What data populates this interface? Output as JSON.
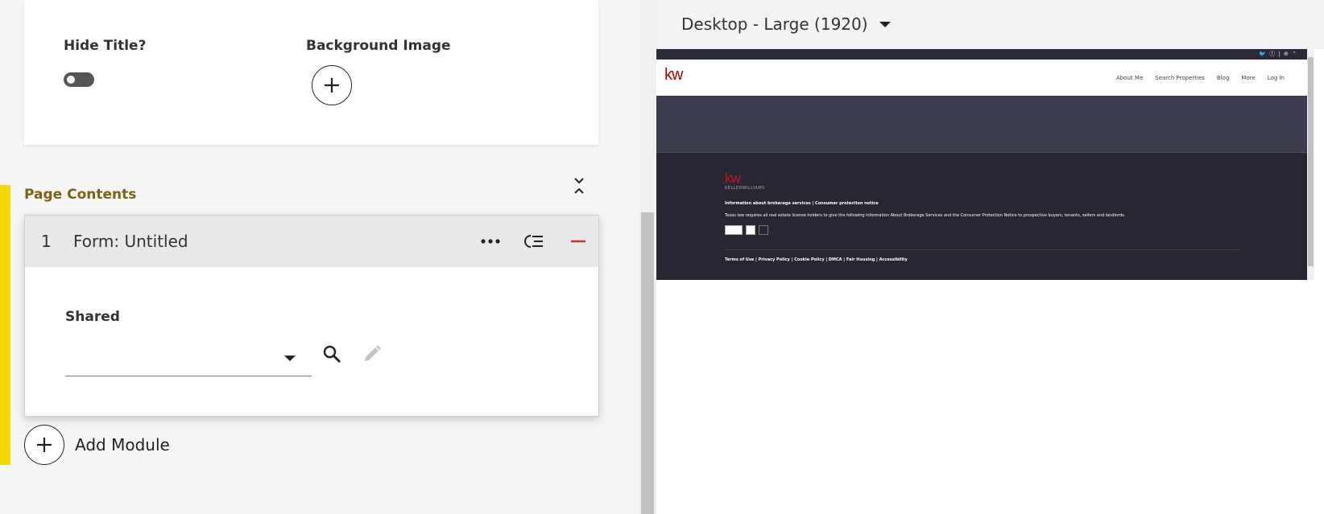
{
  "settings": {
    "hide_title_label": "Hide Title?",
    "hide_title_value": false,
    "background_image_label": "Background Image"
  },
  "page_contents": {
    "label": "Page Contents",
    "modules": [
      {
        "index": "1",
        "title": "Form: Untitled",
        "shared_label": "Shared",
        "shared_value": ""
      }
    ],
    "add_module_label": "Add Module"
  },
  "preview": {
    "device_label": "Desktop - Large (1920)",
    "logo": "kw",
    "topbar_icons": "🐦 ⓕ | ⊕ ⌃",
    "nav_items": [
      "About Me",
      "Search Properties",
      "Blog",
      "More",
      "Log In"
    ],
    "footer": {
      "logo": "kw",
      "logo_sub": "KELLERWILLIAMS",
      "links_line": "Information about brokerage services  |  Consumer protection notice",
      "notice": "Texas law requires all real estate license holders to give the following information About Brokerage Services and the Consumer Protection Notice to prospective buyers, tenants, sellers and landlords.",
      "legal_links": "Terms of Use | Privacy Policy | Cookie Policy | DMCA | Fair Housing | Accessibility"
    }
  },
  "colors": {
    "accent_yellow": "#f5d800",
    "section_label": "#7a6410",
    "remove_red": "#c0392b",
    "brand_red": "#b40101"
  }
}
